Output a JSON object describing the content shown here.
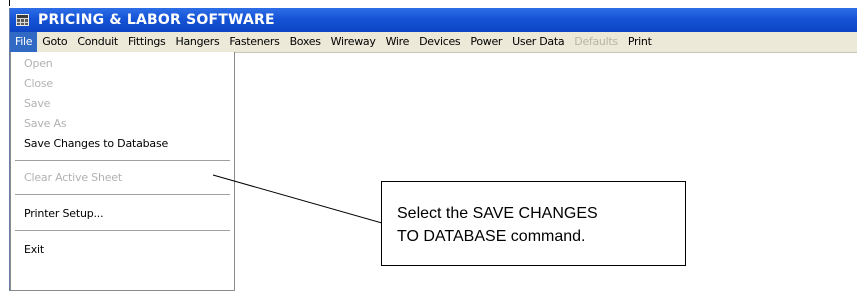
{
  "window": {
    "title": "PRICING & LABOR SOFTWARE",
    "icon": "app-grid-icon"
  },
  "menubar": {
    "items": [
      {
        "label": "File",
        "state": "active"
      },
      {
        "label": "Goto",
        "state": "normal"
      },
      {
        "label": "Conduit",
        "state": "normal"
      },
      {
        "label": "Fittings",
        "state": "normal"
      },
      {
        "label": "Hangers",
        "state": "normal"
      },
      {
        "label": "Fasteners",
        "state": "normal"
      },
      {
        "label": "Boxes",
        "state": "normal"
      },
      {
        "label": "Wireway",
        "state": "normal"
      },
      {
        "label": "Wire",
        "state": "normal"
      },
      {
        "label": "Devices",
        "state": "normal"
      },
      {
        "label": "Power",
        "state": "normal"
      },
      {
        "label": "User Data",
        "state": "normal"
      },
      {
        "label": "Defaults",
        "state": "disabled"
      },
      {
        "label": "Print",
        "state": "normal"
      }
    ]
  },
  "file_menu": {
    "items": [
      {
        "label": "Open",
        "enabled": false
      },
      {
        "label": "Close",
        "enabled": false
      },
      {
        "label": "Save",
        "enabled": false
      },
      {
        "label": "Save As",
        "enabled": false
      },
      {
        "label": "Save Changes to Database",
        "enabled": true
      },
      {
        "label": "Clear Active Sheet",
        "enabled": false
      },
      {
        "label": "Printer Setup...",
        "enabled": true
      },
      {
        "label": "Exit",
        "enabled": true
      }
    ]
  },
  "callout": {
    "text": "Select the SAVE CHANGES\nTO DATABASE command."
  },
  "colors": {
    "titlebar": "#1553d6",
    "menu_highlight": "#316ac5",
    "menubar_bg": "#ece9d8",
    "disabled_text": "#b2b2b2"
  }
}
